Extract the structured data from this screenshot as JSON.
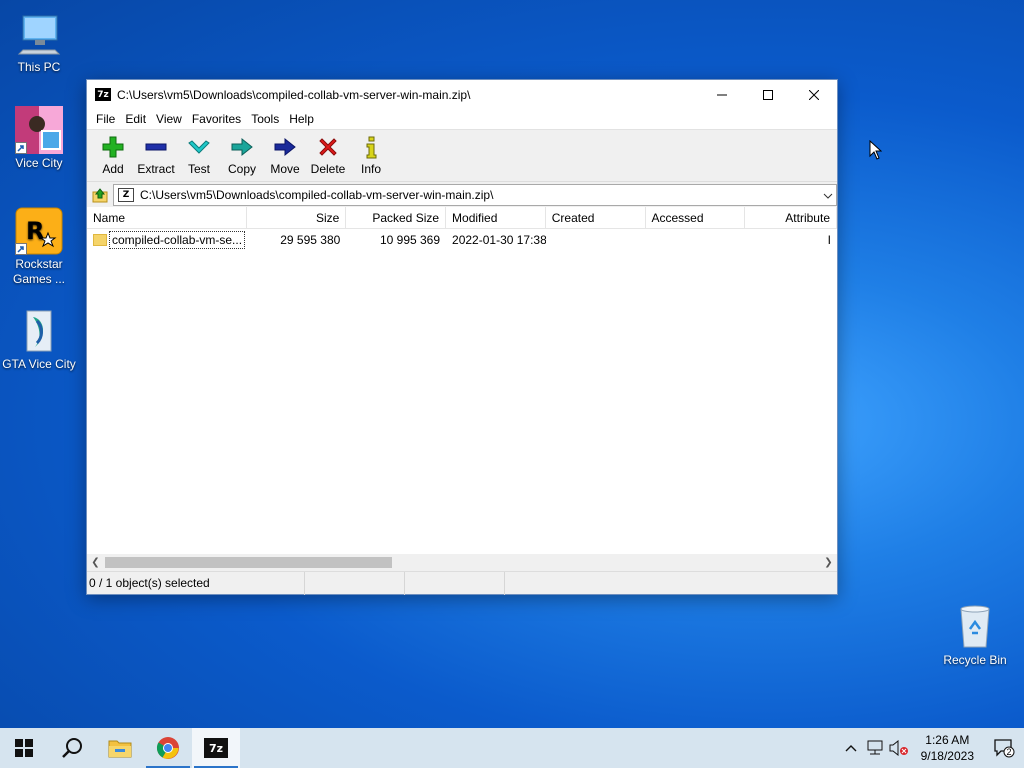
{
  "desktop": {
    "icons": [
      {
        "label": "This PC"
      },
      {
        "label": "Vice City"
      },
      {
        "label": "Rockstar Games ..."
      },
      {
        "label": "GTA Vice City"
      },
      {
        "label": "Recycle Bin"
      }
    ]
  },
  "window": {
    "app_icon": "7z",
    "title": "C:\\Users\\vm5\\Downloads\\compiled-collab-vm-server-win-main.zip\\",
    "menu": [
      "File",
      "Edit",
      "View",
      "Favorites",
      "Tools",
      "Help"
    ],
    "toolbar": [
      {
        "label": "Add",
        "icon": "add-icon"
      },
      {
        "label": "Extract",
        "icon": "extract-icon"
      },
      {
        "label": "Test",
        "icon": "test-icon"
      },
      {
        "label": "Copy",
        "icon": "copy-icon"
      },
      {
        "label": "Move",
        "icon": "move-icon"
      },
      {
        "label": "Delete",
        "icon": "delete-icon"
      },
      {
        "label": "Info",
        "icon": "info-icon"
      }
    ],
    "address": "C:\\Users\\vm5\\Downloads\\compiled-collab-vm-server-win-main.zip\\",
    "columns": [
      "Name",
      "Size",
      "Packed Size",
      "Modified",
      "Created",
      "Accessed",
      "Attribute"
    ],
    "rows": [
      {
        "name": "compiled-collab-vm-se...",
        "size": "29 595 380",
        "packed": "10 995 369",
        "modified": "2022-01-30 17:38",
        "created": "",
        "accessed": "",
        "attr": "I"
      }
    ],
    "status": "0 / 1 object(s) selected"
  },
  "taskbar": {
    "time": "1:26 AM",
    "date": "9/18/2023",
    "notifications": "2",
    "accent": "#2b74c9"
  }
}
